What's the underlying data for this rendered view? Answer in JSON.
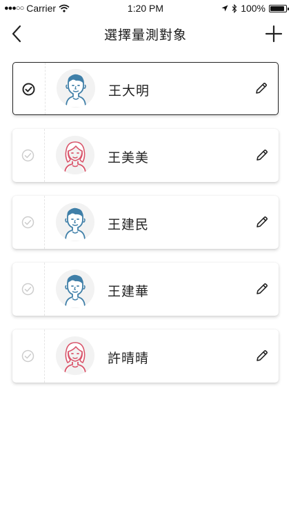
{
  "status_bar": {
    "carrier": "Carrier",
    "time": "1:20 PM",
    "battery": "100%"
  },
  "nav": {
    "title": "選擇量測對象"
  },
  "users": [
    {
      "name": "王大明",
      "gender": "male",
      "selected": true
    },
    {
      "name": "王美美",
      "gender": "female",
      "selected": false
    },
    {
      "name": "王建民",
      "gender": "male",
      "selected": false
    },
    {
      "name": "王建華",
      "gender": "male",
      "selected": false
    },
    {
      "name": "許晴晴",
      "gender": "female",
      "selected": false
    }
  ],
  "colors": {
    "male_accent": "#3f7fa8",
    "female_accent": "#d9546a",
    "check_active": "#222222",
    "check_inactive": "#cccccc"
  }
}
